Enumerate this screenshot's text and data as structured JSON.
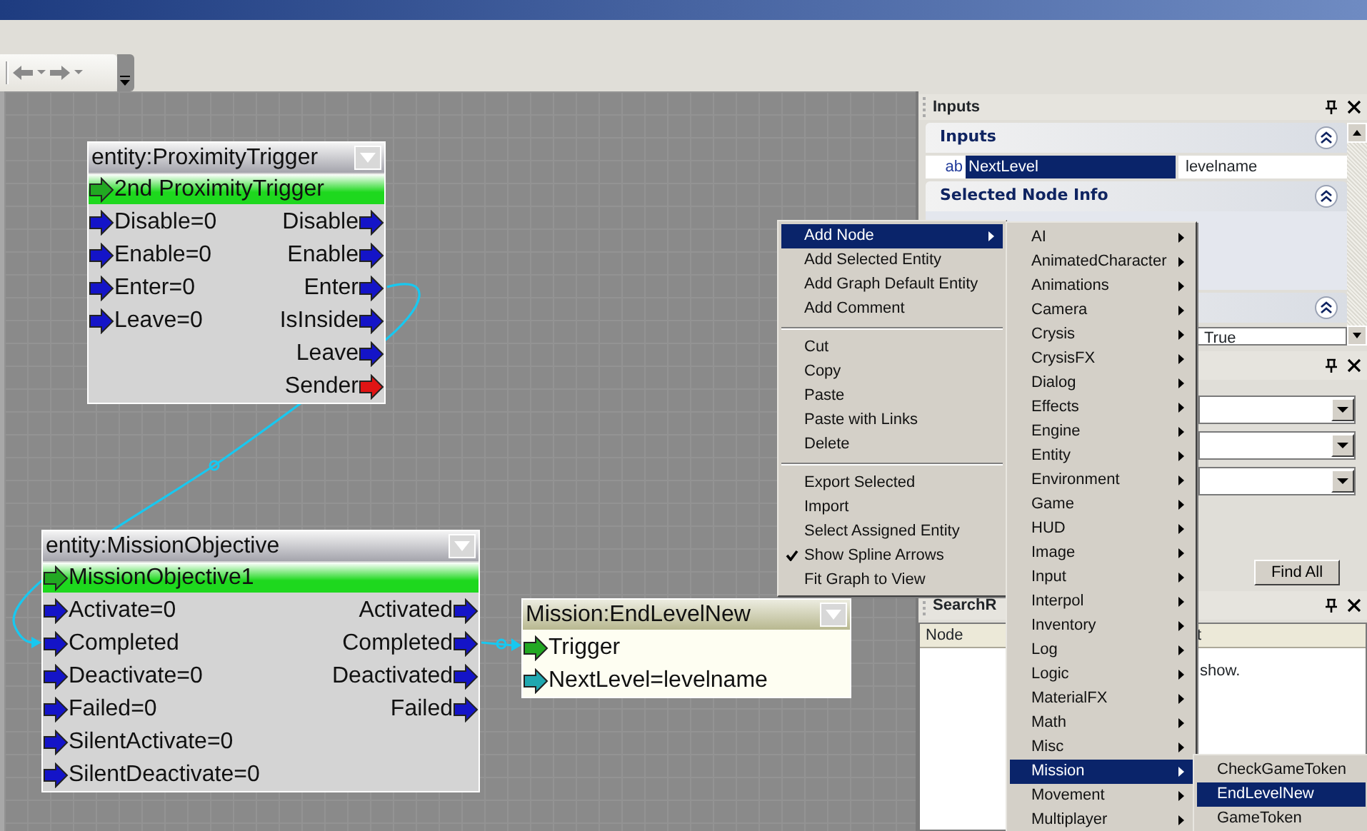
{
  "graph": {
    "nodes": [
      {
        "kind": "entity",
        "title": "entity:ProximityTrigger",
        "entity": "2nd ProximityTrigger",
        "inputs": [
          {
            "label": "Disable=0",
            "color": "#1414c8"
          },
          {
            "label": "Enable=0",
            "color": "#1414c8"
          },
          {
            "label": "Enter=0",
            "color": "#1414c8"
          },
          {
            "label": "Leave=0",
            "color": "#1414c8"
          }
        ],
        "outputs": [
          {
            "label": "Disable",
            "color": "#1414c8"
          },
          {
            "label": "Enable",
            "color": "#1414c8"
          },
          {
            "label": "Enter",
            "color": "#1414c8"
          },
          {
            "label": "IsInside",
            "color": "#1414c8"
          },
          {
            "label": "Leave",
            "color": "#1414c8"
          },
          {
            "label": "Sender",
            "color": "#e01414"
          }
        ]
      },
      {
        "kind": "entity",
        "title": "entity:MissionObjective",
        "entity": "MissionObjective1",
        "inputs": [
          {
            "label": "Activate=0",
            "color": "#1414c8"
          },
          {
            "label": "Completed",
            "color": "#1414c8"
          },
          {
            "label": "Deactivate=0",
            "color": "#1414c8"
          },
          {
            "label": "Failed=0",
            "color": "#1414c8"
          },
          {
            "label": "SilentActivate=0",
            "color": "#1414c8"
          },
          {
            "label": "SilentDeactivate=0",
            "color": "#1414c8"
          }
        ],
        "outputs": [
          {
            "label": "Activated",
            "color": "#1414c8"
          },
          {
            "label": "Completed",
            "color": "#1414c8"
          },
          {
            "label": "Deactivated",
            "color": "#1414c8"
          },
          {
            "label": "Failed",
            "color": "#1414c8"
          }
        ]
      },
      {
        "kind": "mission",
        "title": "Mission:EndLevelNew",
        "inputs": [
          {
            "label": "Trigger",
            "color": "#22a822"
          },
          {
            "label": "NextLevel=levelname",
            "color": "#20a8b0"
          }
        ]
      }
    ]
  },
  "inputs_panel": {
    "title": "Inputs",
    "inputs_section": {
      "title": "Inputs",
      "property": {
        "type_icon": "ab",
        "name": "NextLevel",
        "value": "levelname",
        "selected": true
      }
    },
    "node_info_section": {
      "title": "Selected Node Info"
    },
    "third_section": {
      "value": "True"
    }
  },
  "search_panel": {
    "find_button": "Find All"
  },
  "results_panel": {
    "title": "SearchR",
    "columns": [
      "Node",
      "t"
    ],
    "message": "show."
  },
  "context_menu": {
    "items": [
      {
        "kind": "item",
        "label": "Add Node",
        "selected": true,
        "checked": false,
        "submenu": true
      },
      {
        "kind": "item",
        "label": "Add Selected Entity",
        "selected": false,
        "checked": false,
        "submenu": false
      },
      {
        "kind": "item",
        "label": "Add Graph Default Entity",
        "selected": false,
        "checked": false,
        "submenu": false
      },
      {
        "kind": "item",
        "label": "Add Comment",
        "selected": false,
        "checked": false,
        "submenu": false
      },
      {
        "kind": "separator"
      },
      {
        "kind": "item",
        "label": "Cut",
        "selected": false,
        "checked": false,
        "submenu": false
      },
      {
        "kind": "item",
        "label": "Copy",
        "selected": false,
        "checked": false,
        "submenu": false
      },
      {
        "kind": "item",
        "label": "Paste",
        "selected": false,
        "checked": false,
        "submenu": false
      },
      {
        "kind": "item",
        "label": "Paste with Links",
        "selected": false,
        "checked": false,
        "submenu": false
      },
      {
        "kind": "item",
        "label": "Delete",
        "selected": false,
        "checked": false,
        "submenu": false
      },
      {
        "kind": "separator"
      },
      {
        "kind": "item",
        "label": "Export Selected",
        "selected": false,
        "checked": false,
        "submenu": false
      },
      {
        "kind": "item",
        "label": "Import",
        "selected": false,
        "checked": false,
        "submenu": false
      },
      {
        "kind": "item",
        "label": "Select Assigned Entity",
        "selected": false,
        "checked": false,
        "submenu": false
      },
      {
        "kind": "item",
        "label": "Show Spline Arrows",
        "selected": false,
        "checked": true,
        "submenu": false
      },
      {
        "kind": "item",
        "label": "Fit Graph to View",
        "selected": false,
        "checked": false,
        "submenu": false
      }
    ]
  },
  "submenu": {
    "items": [
      {
        "label": "AI",
        "selected": false
      },
      {
        "label": "AnimatedCharacter",
        "selected": false
      },
      {
        "label": "Animations",
        "selected": false
      },
      {
        "label": "Camera",
        "selected": false
      },
      {
        "label": "Crysis",
        "selected": false
      },
      {
        "label": "CrysisFX",
        "selected": false
      },
      {
        "label": "Dialog",
        "selected": false
      },
      {
        "label": "Effects",
        "selected": false
      },
      {
        "label": "Engine",
        "selected": false
      },
      {
        "label": "Entity",
        "selected": false
      },
      {
        "label": "Environment",
        "selected": false
      },
      {
        "label": "Game",
        "selected": false
      },
      {
        "label": "HUD",
        "selected": false
      },
      {
        "label": "Image",
        "selected": false
      },
      {
        "label": "Input",
        "selected": false
      },
      {
        "label": "Interpol",
        "selected": false
      },
      {
        "label": "Inventory",
        "selected": false
      },
      {
        "label": "Log",
        "selected": false
      },
      {
        "label": "Logic",
        "selected": false
      },
      {
        "label": "MaterialFX",
        "selected": false
      },
      {
        "label": "Math",
        "selected": false
      },
      {
        "label": "Misc",
        "selected": false
      },
      {
        "label": "Mission",
        "selected": true
      },
      {
        "label": "Movement",
        "selected": false
      },
      {
        "label": "Multiplayer",
        "selected": false
      }
    ]
  },
  "mission_submenu": {
    "items": [
      {
        "label": "CheckGameToken",
        "selected": false
      },
      {
        "label": "EndLevelNew",
        "selected": true
      },
      {
        "label": "GameToken",
        "selected": false
      }
    ]
  }
}
